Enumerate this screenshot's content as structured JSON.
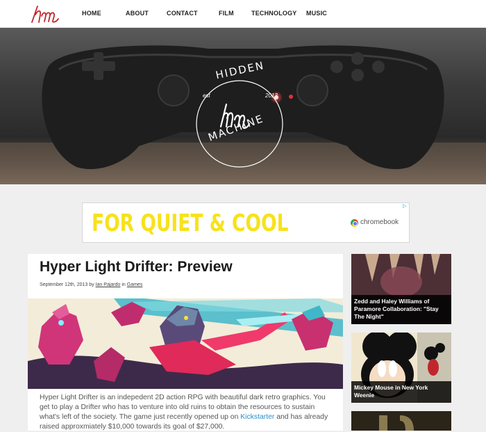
{
  "nav": {
    "items": [
      {
        "label": "HOME"
      },
      {
        "label": "ABOUT"
      },
      {
        "label": "CONTACT"
      },
      {
        "label": "FILM"
      },
      {
        "label": "TECHNOLOGY"
      },
      {
        "label": "MUSIC"
      }
    ]
  },
  "hero": {
    "badge_top": "HIDDEN",
    "badge_bottom": "MACHINE",
    "badge_left": "est",
    "badge_right": "2013",
    "monogram": "hm"
  },
  "ad": {
    "headline": "FOR QUIET & COOL",
    "brand": "chromebook",
    "adchoices": "▷"
  },
  "article": {
    "title": "Hyper Light Drifter: Preview",
    "date": "September 12th, 2013",
    "by": "by",
    "author": "Ian Pajardo",
    "in": "in",
    "category": "Games",
    "body_1": "Hyper Light Drifter is an indepedent 2D action RPG with beautiful dark retro graphics. You get to play a Drifter who has to venture into old ruins to obtain the resources to sustain what's left of the society. The game just recently opened up on",
    "body_link": "Kickstarter",
    "body_2": "and has already raised approxmiately $10,000 towards its goal of $27,000."
  },
  "sidebar": {
    "cards": [
      {
        "caption": "Zedd and Haley Williams of Paramore Collaboration: \"Stay The Night\""
      },
      {
        "caption": "Mickey Mouse in New York Weenie"
      },
      {
        "caption": ""
      }
    ]
  },
  "colors": {
    "accent_red": "#c0272d",
    "ad_yellow": "#f7e21b",
    "link_blue": "#2a8fc7"
  }
}
